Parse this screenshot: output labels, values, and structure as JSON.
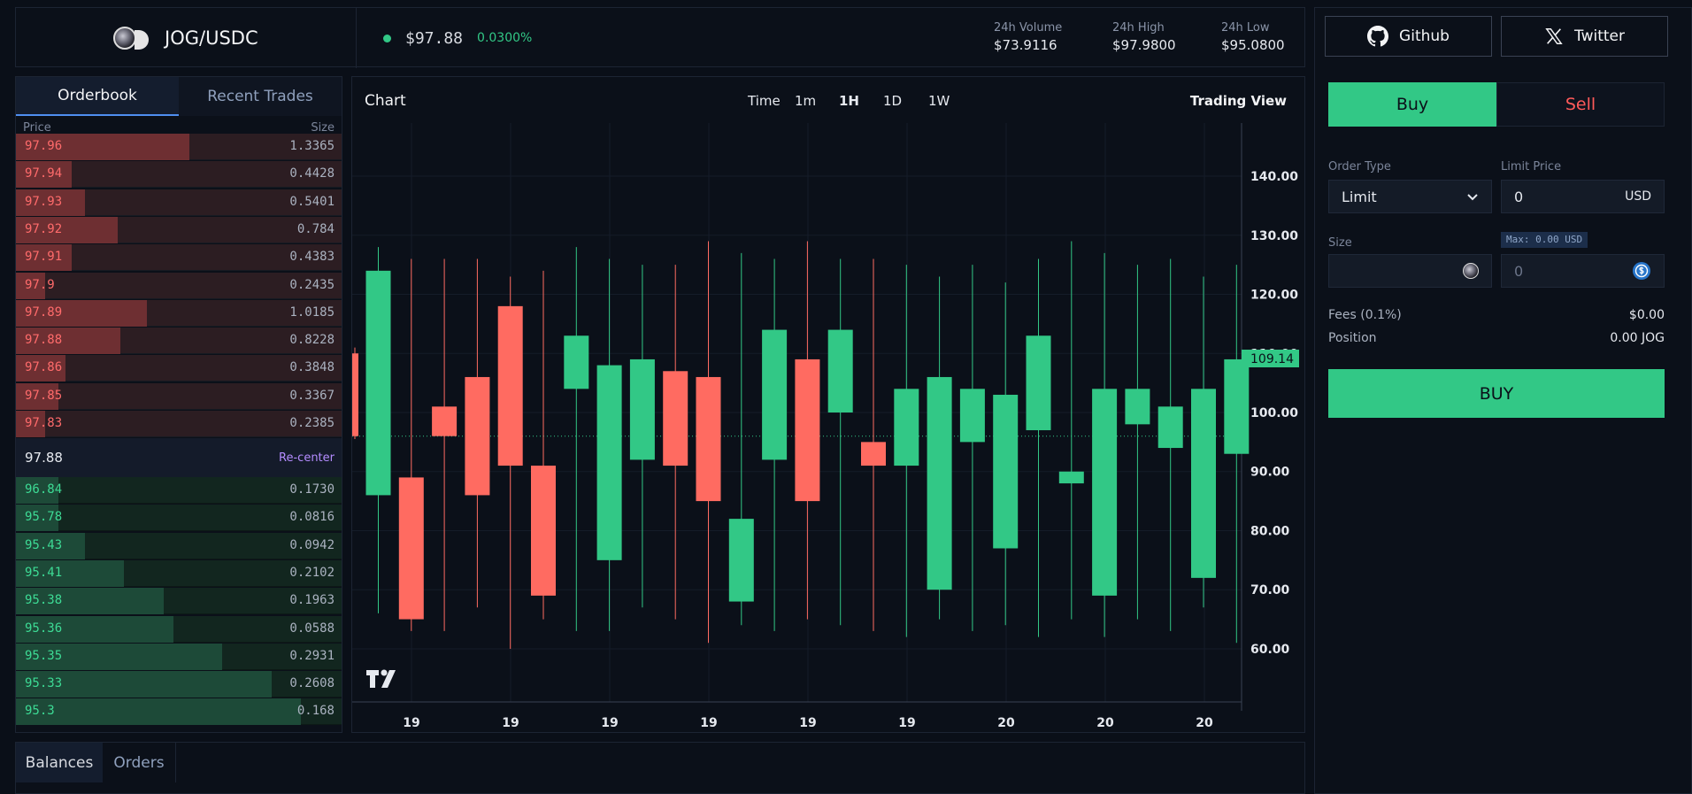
{
  "header": {
    "pair": "JOG/USDC",
    "price": "$97.88",
    "change": "0.0300%",
    "stats": [
      {
        "label": "24h Volume",
        "value": "$73.9116"
      },
      {
        "label": "24h High",
        "value": "$97.9800"
      },
      {
        "label": "24h Low",
        "value": "$95.0800"
      }
    ]
  },
  "social": {
    "github": "Github",
    "twitter": "Twitter"
  },
  "orderbook": {
    "tabs": [
      "Orderbook",
      "Recent Trades"
    ],
    "price_header": "Price",
    "size_header": "Size",
    "asks": [
      {
        "price": "97.96",
        "size": "1.3365",
        "fill": 0.53
      },
      {
        "price": "97.94",
        "size": "0.4428",
        "fill": 0.17
      },
      {
        "price": "97.93",
        "size": "0.5401",
        "fill": 0.21
      },
      {
        "price": "97.92",
        "size": "0.784",
        "fill": 0.31
      },
      {
        "price": "97.91",
        "size": "0.4383",
        "fill": 0.17
      },
      {
        "price": "97.9",
        "size": "0.2435",
        "fill": 0.09
      },
      {
        "price": "97.89",
        "size": "1.0185",
        "fill": 0.4
      },
      {
        "price": "97.88",
        "size": "0.8228",
        "fill": 0.32
      },
      {
        "price": "97.86",
        "size": "0.3848",
        "fill": 0.15
      },
      {
        "price": "97.85",
        "size": "0.3367",
        "fill": 0.13
      },
      {
        "price": "97.83",
        "size": "0.2385",
        "fill": 0.09
      }
    ],
    "mid_price": "97.88",
    "recenter": "Re-center",
    "bids": [
      {
        "price": "96.84",
        "size": "0.1730",
        "fill": 0.13
      },
      {
        "price": "95.78",
        "size": "0.0816",
        "fill": 0.13
      },
      {
        "price": "95.43",
        "size": "0.0942",
        "fill": 0.21
      },
      {
        "price": "95.41",
        "size": "0.2102",
        "fill": 0.33
      },
      {
        "price": "95.38",
        "size": "0.1963",
        "fill": 0.45
      },
      {
        "price": "95.36",
        "size": "0.0588",
        "fill": 0.48
      },
      {
        "price": "95.35",
        "size": "0.2931",
        "fill": 0.63
      },
      {
        "price": "95.33",
        "size": "0.2608",
        "fill": 0.78
      },
      {
        "price": "95.3",
        "size": "0.168",
        "fill": 0.87
      }
    ]
  },
  "chart": {
    "title": "Chart",
    "timeframes": [
      "Time",
      "1m",
      "1H",
      "1D",
      "1W"
    ],
    "active_timeframe": "1H",
    "trading_view": "Trading View"
  },
  "chart_data": {
    "type": "candlestick",
    "y_ticks": [
      140,
      130,
      120,
      110,
      100,
      90,
      80,
      70,
      60
    ],
    "ylim": [
      51,
      149
    ],
    "last_price_label": "109.14",
    "last_price_value": 109.14,
    "current_price_value": 96.0,
    "x_tick_labels": [
      "19",
      "19",
      "19",
      "19",
      "19",
      "19",
      "20",
      "20",
      "20"
    ],
    "up_color": "#32c886",
    "down_color": "#ff6b61",
    "candles": [
      {
        "o": 110.0,
        "c": 96.0,
        "h": 111.0,
        "l": 95.5
      },
      {
        "o": 86.0,
        "c": 124.0,
        "h": 128.0,
        "l": 66.0
      },
      {
        "o": 89.0,
        "c": 65.0,
        "h": 126.0,
        "l": 63.0
      },
      {
        "o": 101.0,
        "c": 96.0,
        "h": 126.0,
        "l": 63.0
      },
      {
        "o": 106.0,
        "c": 86.0,
        "h": 126.0,
        "l": 67.0
      },
      {
        "o": 118.0,
        "c": 91.0,
        "h": 123.0,
        "l": 60.0
      },
      {
        "o": 91.0,
        "c": 69.0,
        "h": 124.0,
        "l": 65.0
      },
      {
        "o": 104.0,
        "c": 113.0,
        "h": 128.0,
        "l": 63.0
      },
      {
        "o": 75.0,
        "c": 108.0,
        "h": 126.0,
        "l": 63.0
      },
      {
        "o": 92.0,
        "c": 109.0,
        "h": 125.0,
        "l": 67.0
      },
      {
        "o": 107.0,
        "c": 91.0,
        "h": 125.0,
        "l": 65.0
      },
      {
        "o": 106.0,
        "c": 85.0,
        "h": 129.0,
        "l": 61.0
      },
      {
        "o": 68.0,
        "c": 82.0,
        "h": 127.0,
        "l": 64.0
      },
      {
        "o": 92.0,
        "c": 114.0,
        "h": 126.0,
        "l": 63.0
      },
      {
        "o": 109.0,
        "c": 85.0,
        "h": 129.0,
        "l": 65.0
      },
      {
        "o": 100.0,
        "c": 114.0,
        "h": 126.0,
        "l": 64.0
      },
      {
        "o": 95.0,
        "c": 91.0,
        "h": 126.0,
        "l": 63.0
      },
      {
        "o": 91.0,
        "c": 104.0,
        "h": 125.0,
        "l": 62.0
      },
      {
        "o": 70.0,
        "c": 106.0,
        "h": 123.0,
        "l": 65.0
      },
      {
        "o": 95.0,
        "c": 104.0,
        "h": 125.0,
        "l": 63.0
      },
      {
        "o": 77.0,
        "c": 103.0,
        "h": 122.0,
        "l": 64.0
      },
      {
        "o": 97.0,
        "c": 113.0,
        "h": 126.0,
        "l": 62.0
      },
      {
        "o": 88.0,
        "c": 90.0,
        "h": 129.0,
        "l": 65.0
      },
      {
        "o": 69.0,
        "c": 104.0,
        "h": 127.0,
        "l": 62.0
      },
      {
        "o": 98.0,
        "c": 104.0,
        "h": 125.0,
        "l": 65.0
      },
      {
        "o": 94.0,
        "c": 101.0,
        "h": 126.0,
        "l": 63.0
      },
      {
        "o": 72.0,
        "c": 104.0,
        "h": 123.0,
        "l": 67.0
      },
      {
        "o": 93.0,
        "c": 109.0,
        "h": 125.0,
        "l": 61.0
      }
    ]
  },
  "form": {
    "buy": "Buy",
    "sell": "Sell",
    "order_type_label": "Order Type",
    "order_type_value": "Limit",
    "limit_price_label": "Limit Price",
    "limit_price_value": "0",
    "limit_price_unit": "USD",
    "size_label": "Size",
    "max_badge": "Max: 0.00 USD",
    "size_usd_placeholder": "0",
    "fees_label": "Fees (0.1%)",
    "fees_value": "$0.00",
    "position_label": "Position",
    "position_value": "0.00 JOG",
    "submit": "BUY"
  },
  "bottom": {
    "tabs": [
      "Balances",
      "Orders"
    ]
  }
}
